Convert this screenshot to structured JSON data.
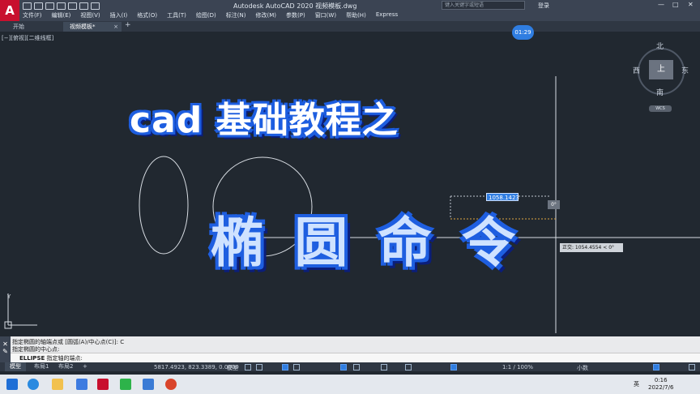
{
  "window": {
    "title": "Autodesk AutoCAD 2020    视频模板.dwg",
    "search_placeholder": "键入关键字或短语",
    "login_label": "登录",
    "logo_letter": "A",
    "min_icon": "minimize-icon",
    "max_icon": "maximize-icon",
    "close_icon": "close-icon"
  },
  "menu": [
    "文件(F)",
    "编辑(E)",
    "视图(V)",
    "插入(I)",
    "格式(O)",
    "工具(T)",
    "绘图(D)",
    "标注(N)",
    "修改(M)",
    "参数(P)",
    "窗口(W)",
    "帮助(H)",
    "Express"
  ],
  "tabs": [
    {
      "label": "开始",
      "active": false
    },
    {
      "label": "视频模板*",
      "active": true
    }
  ],
  "tab_add": "+",
  "tab_close": "×",
  "view_label": "[−][俯视][二维线框]",
  "timer": "01:29",
  "overlay": {
    "headline": "cad 基础教程之",
    "sub_chars": [
      "椭",
      "圆",
      "命",
      "令"
    ]
  },
  "dynamic_input": {
    "length": "1058.1423",
    "angle": "0°",
    "polar": "正交: 1054.4554 < 0°"
  },
  "viewcube": {
    "north": "北",
    "south": "南",
    "west": "西",
    "east": "东",
    "top": "上",
    "wcs": "WCS"
  },
  "ucs": {
    "y_label": "Y"
  },
  "command": {
    "history": [
      "指定椭圆的轴端点或 [圆弧(A)/中心点(C)]: C",
      "指定椭圆的中心点:"
    ],
    "prompt_keyword": "ELLIPSE",
    "prompt_text": " 指定轴的端点:"
  },
  "layout_tabs": [
    {
      "label": "模型",
      "active": true
    },
    {
      "label": "布局1",
      "active": false
    },
    {
      "label": "布局2",
      "active": false
    }
  ],
  "layout_add": "+",
  "status": {
    "coords": "5817.4923, 823.3389, 0.0000",
    "model": "模型",
    "scale": "1:1 / 100%",
    "units": "小数"
  },
  "taskbar": {
    "time": "0:16",
    "date": "2022/7/6",
    "ime": "英"
  },
  "colors": {
    "accent": "#2f7de1",
    "canvas": "#212830",
    "title_outline": "#1f5fe0"
  }
}
